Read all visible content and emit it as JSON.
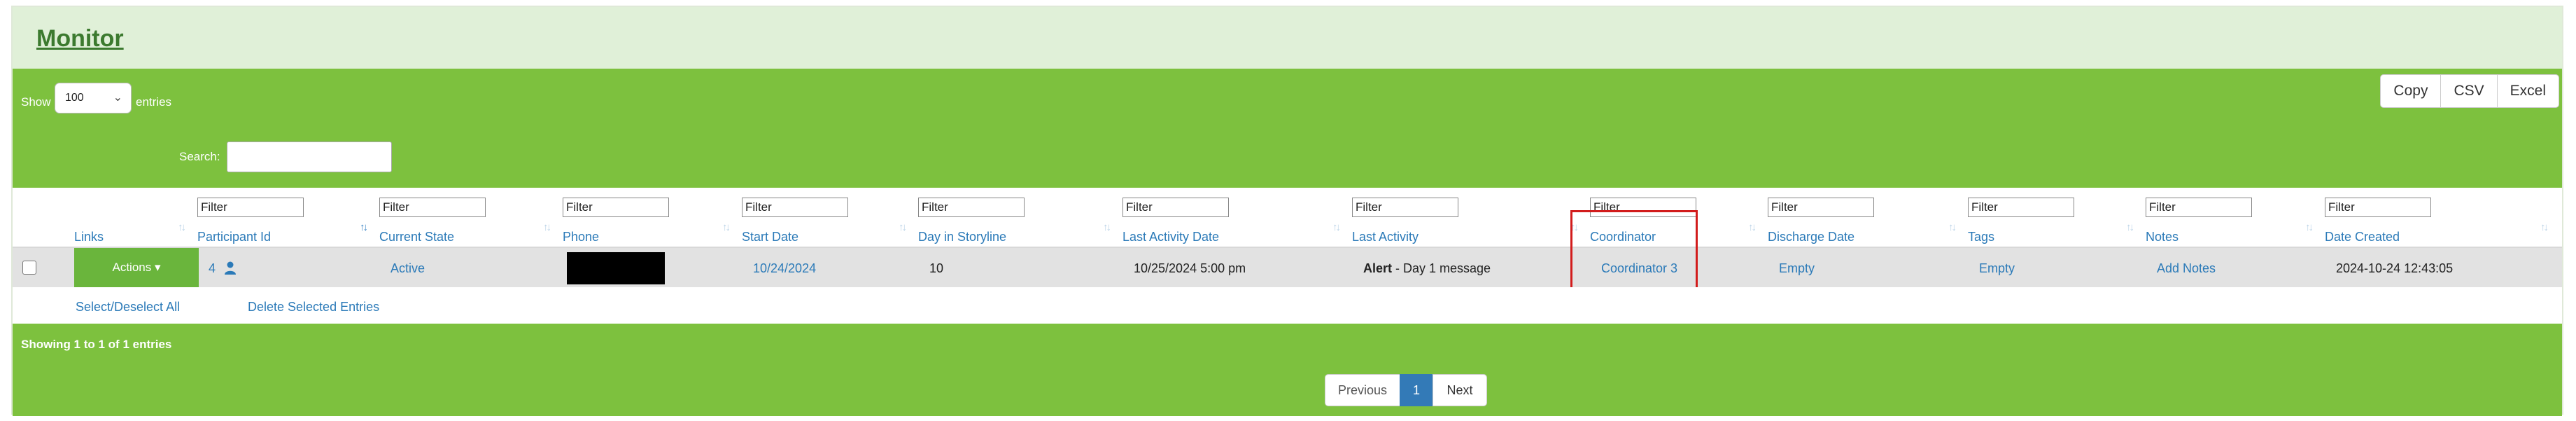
{
  "page_title": "Monitor",
  "length_menu": {
    "show": "Show",
    "value": "100",
    "entries": "entries"
  },
  "search": {
    "label": "Search:",
    "value": ""
  },
  "export_buttons": [
    "Copy",
    "CSV",
    "Excel"
  ],
  "filter_placeholder": "Filter",
  "columns": [
    "Links",
    "Participant Id",
    "Current State",
    "Phone",
    "Start Date",
    "Day in Storyline",
    "Last Activity Date",
    "Last Activity",
    "Coordinator",
    "Discharge Date",
    "Tags",
    "Notes",
    "Date Created"
  ],
  "row": {
    "actions": "Actions ▾",
    "participant_id": "4",
    "current_state": "Active",
    "start_date": "10/24/2024",
    "day_in_storyline": "10",
    "last_activity_date": "10/25/2024 5:00 pm",
    "last_activity_bold": "Alert",
    "last_activity_rest": " - Day 1 message",
    "coordinator": "Coordinator 3",
    "discharge_date": "Empty",
    "tags": "Empty",
    "notes": "Add Notes",
    "date_created": "2024-10-24 12:43:05"
  },
  "bulk": {
    "select_all": "Select/Deselect All",
    "delete_selected": "Delete Selected Entries"
  },
  "info": "Showing 1 to 1 of 1 entries",
  "pagination": {
    "previous": "Previous",
    "current": "1",
    "next": "Next"
  },
  "colors": {
    "green": "#7dc13e",
    "header_bg": "#e0f0d8",
    "link": "#2b7ab8",
    "highlight": "#d21c1c"
  }
}
